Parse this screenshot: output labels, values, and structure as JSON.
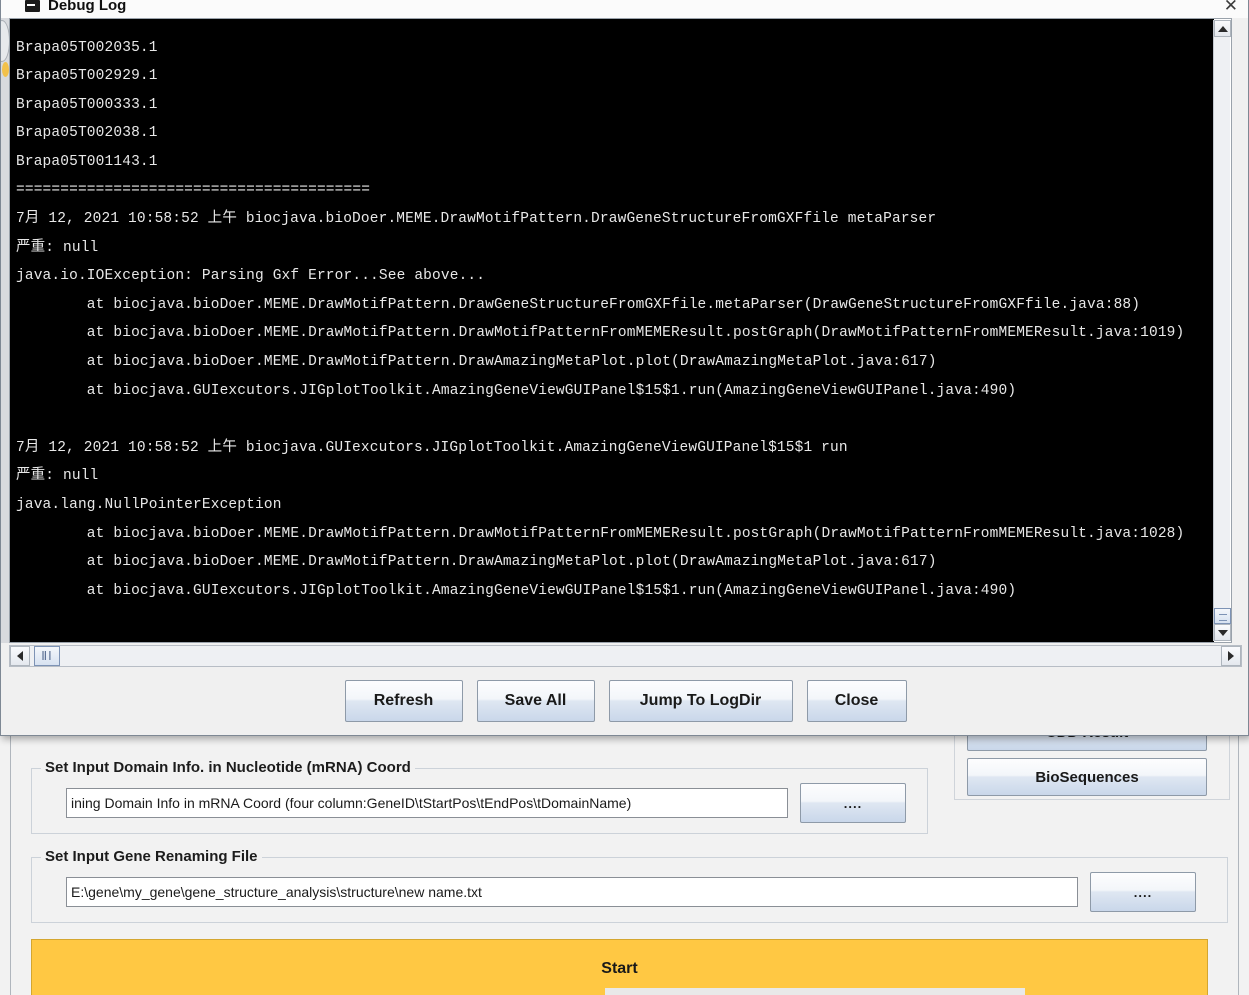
{
  "dialog": {
    "title": "Debug Log",
    "icon": "log-window-icon",
    "close_glyph": "✕",
    "buttons": [
      {
        "id": "refresh",
        "label": "Refresh"
      },
      {
        "id": "save-all",
        "label": "Save All"
      },
      {
        "id": "jump",
        "label": "Jump To LogDir"
      },
      {
        "id": "close",
        "label": "Close"
      }
    ],
    "log_text": "Brapa05T002035.1\nBrapa05T002929.1\nBrapa05T000333.1\nBrapa05T002038.1\nBrapa05T001143.1\n========================================\n7月 12, 2021 10:58:52 上午 biocjava.bioDoer.MEME.DrawMotifPattern.DrawGeneStructureFromGXFfile metaParser\n严重: null\njava.io.IOException: Parsing Gxf Error...See above...\n        at biocjava.bioDoer.MEME.DrawMotifPattern.DrawGeneStructureFromGXFfile.metaParser(DrawGeneStructureFromGXFfile.java:88)\n        at biocjava.bioDoer.MEME.DrawMotifPattern.DrawMotifPatternFromMEMEResult.postGraph(DrawMotifPatternFromMEMEResult.java:1019)\n        at biocjava.bioDoer.MEME.DrawMotifPattern.DrawAmazingMetaPlot.plot(DrawAmazingMetaPlot.java:617)\n        at biocjava.GUIexcutors.JIGplotToolkit.AmazingGeneViewGUIPanel$15$1.run(AmazingGeneViewGUIPanel.java:490)\n\n7月 12, 2021 10:58:52 上午 biocjava.GUIexcutors.JIGplotToolkit.AmazingGeneViewGUIPanel$15$1 run\n严重: null\njava.lang.NullPointerException\n        at biocjava.bioDoer.MEME.DrawMotifPattern.DrawMotifPatternFromMEMEResult.postGraph(DrawMotifPatternFromMEMEResult.java:1028)\n        at biocjava.bioDoer.MEME.DrawMotifPattern.DrawAmazingMetaPlot.plot(DrawAmazingMetaPlot.java:617)\n        at biocjava.GUIexcutors.JIGplotToolkit.AmazingGeneViewGUIPanel$15$1.run(AmazingGeneViewGUIPanel.java:490)",
    "hscroll_thumb_glyph": "ⅡⅠ"
  },
  "background": {
    "right_buttons": [
      {
        "id": "cdd-result",
        "label": "CDD Result"
      },
      {
        "id": "biosequences",
        "label": "BioSequences"
      }
    ],
    "domain_info_group": {
      "title": "Set Input Domain Info. in Nucleotide (mRNA) Coord",
      "field_value": "ining Domain Info in mRNA Coord (four column:GeneID\\tStartPos\\tEndPos\\tDomainName)",
      "browse_label": "...."
    },
    "gene_renaming_group": {
      "title": "Set Input Gene Renaming File",
      "field_value": "E:\\gene\\my_gene\\gene_structure_analysis\\structure\\new name.txt",
      "browse_label": "...."
    },
    "start_label": "Start",
    "accent_color": "#ffc843"
  }
}
